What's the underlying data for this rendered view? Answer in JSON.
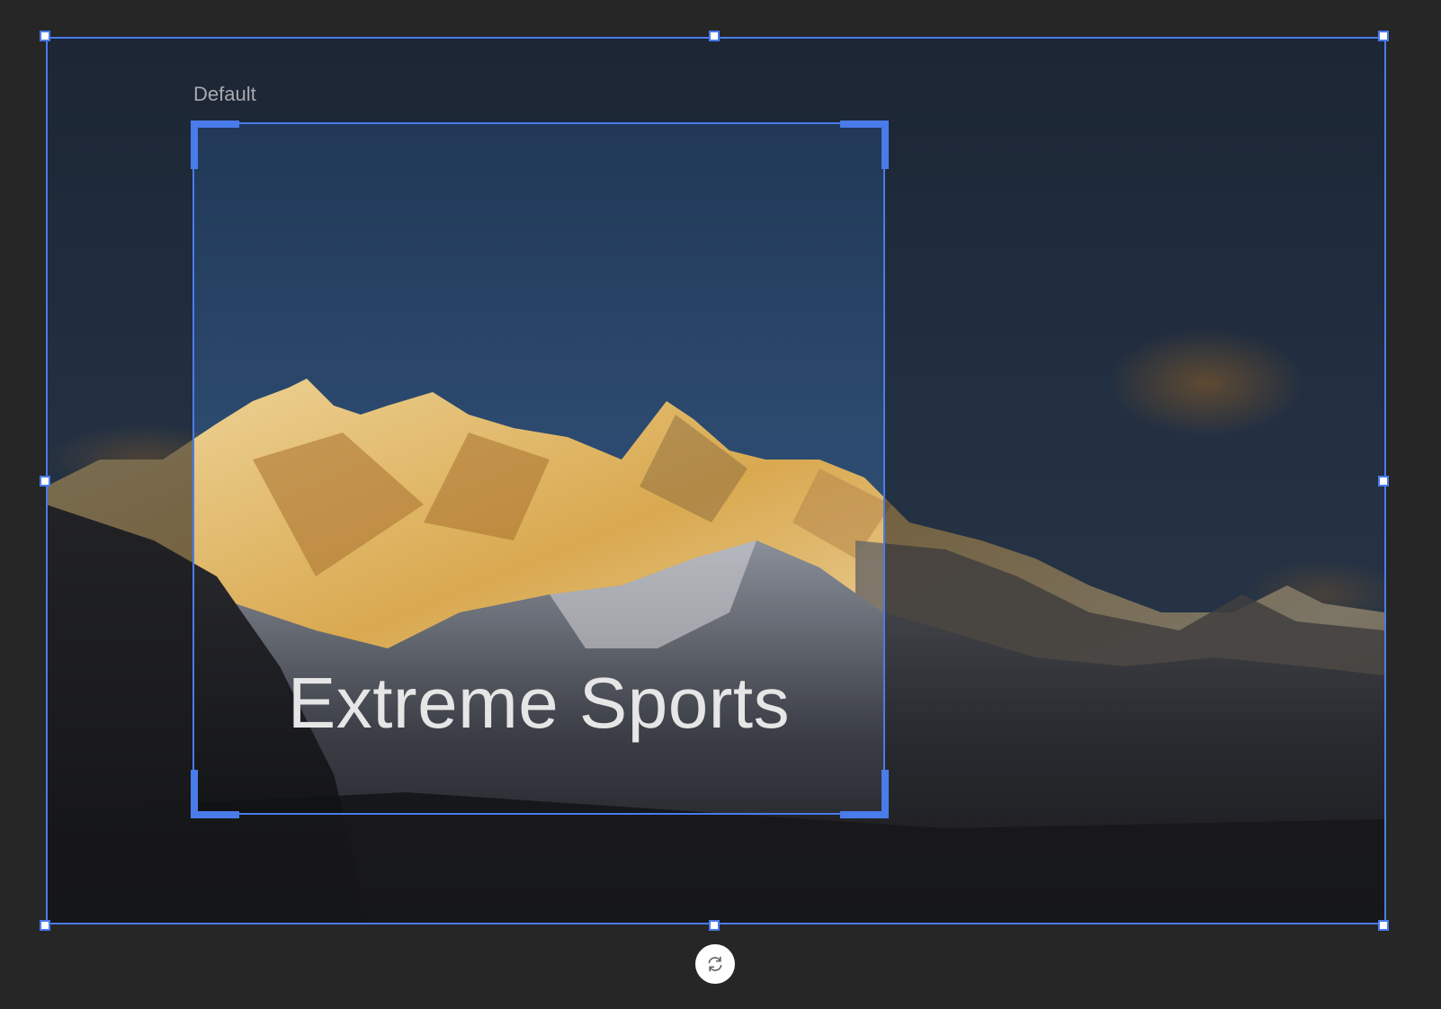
{
  "crop_preset": {
    "label": "Default"
  },
  "image": {
    "overlay_text": "Extreme Sports",
    "subject": "snow-capped mountain range at sunset"
  },
  "controls": {
    "rotate_icon": "rotate-icon"
  },
  "colors": {
    "selection": "#4a7bea",
    "canvas_background": "#262627",
    "label_text": "#a9a9ad",
    "overlay_text": "#e6e6e6"
  }
}
